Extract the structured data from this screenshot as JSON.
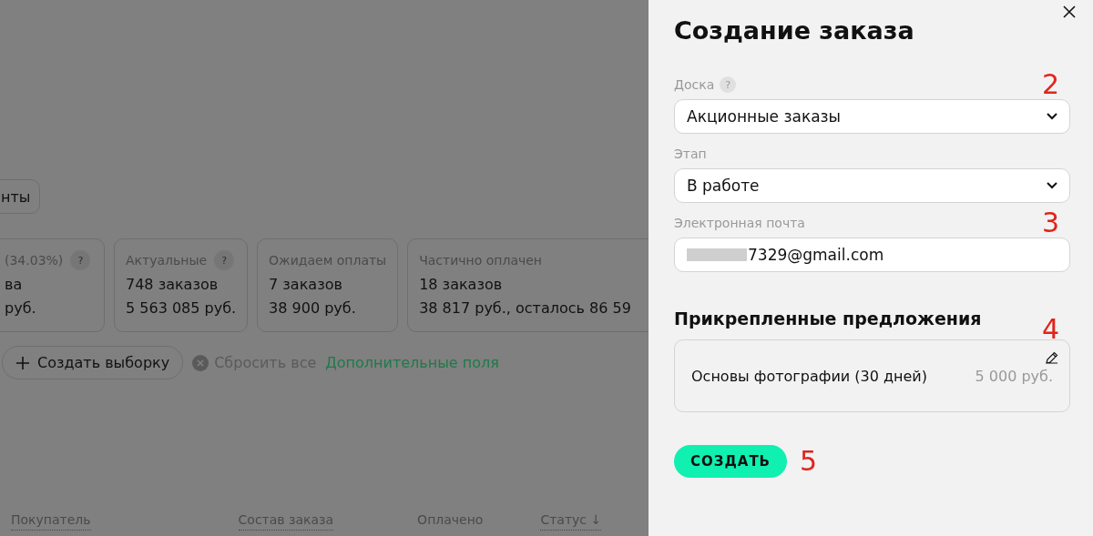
{
  "background": {
    "filter_chip": "нты",
    "stat_cards": [
      {
        "title": "(34.03%)",
        "help": "?",
        "count": "ва",
        "amount": "руб."
      },
      {
        "title": "Актуальные",
        "help": "?",
        "count": "748 заказов",
        "amount": "5 563 085 руб."
      },
      {
        "title": "Ожидаем оплаты",
        "count": "7 заказов",
        "amount": "38 900 руб."
      },
      {
        "title": "Частично оплачен",
        "count": "18 заказов",
        "amount": "38 817 руб., осталось 86 59"
      }
    ],
    "create_selection": "Создать выборку",
    "reset": "Сбросить все",
    "extra_fields": "Дополнительные поля",
    "columns": [
      {
        "label": "Покупатель",
        "underlined": true
      },
      {
        "label": "Состав заказа",
        "underlined": true
      },
      {
        "label": "Оплачено",
        "underlined": false
      },
      {
        "label": "Статус ↓",
        "underlined": true
      }
    ]
  },
  "panel": {
    "title": "Создание заказа",
    "fields": [
      {
        "kind": "select",
        "label": "Доска",
        "help": "?",
        "value": "Акционные заказы",
        "annotation": "2"
      },
      {
        "kind": "select",
        "label": "Этап",
        "value": "В работе"
      },
      {
        "kind": "input",
        "label": "Электронная почта",
        "value": "7329@gmail.com",
        "redacted": true,
        "annotation": "3"
      }
    ],
    "offers_heading": "Прикрепленные предложения",
    "offers_annotation": "4",
    "offers": [
      {
        "name": "Основы фотографии (30 дней)",
        "price": "5 000 руб."
      }
    ],
    "submit": "СОЗДАТЬ",
    "submit_annotation": "5"
  }
}
